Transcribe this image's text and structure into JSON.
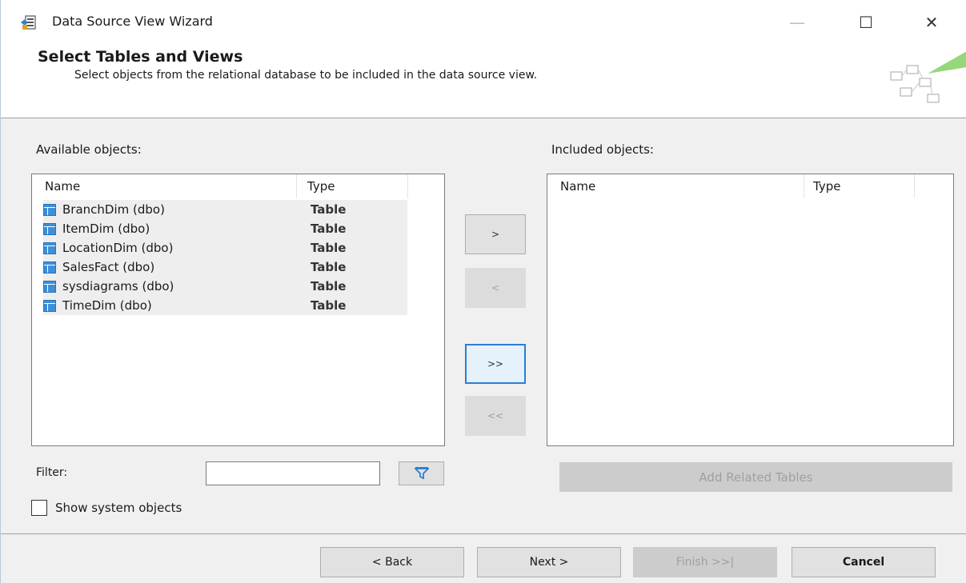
{
  "window": {
    "title": "Data Source View Wizard",
    "controls": {
      "minimize": "—",
      "maximize": "☐",
      "close": "✕"
    }
  },
  "header": {
    "title": "Select Tables and Views",
    "subtitle": "Select objects from the relational database to be included in the data source view."
  },
  "available": {
    "label": "Available objects:",
    "columns": {
      "name": "Name",
      "type": "Type"
    },
    "rows": [
      {
        "name": "BranchDim (dbo)",
        "type": "Table"
      },
      {
        "name": "ItemDim (dbo)",
        "type": "Table"
      },
      {
        "name": "LocationDim (dbo)",
        "type": "Table"
      },
      {
        "name": "SalesFact (dbo)",
        "type": "Table"
      },
      {
        "name": "sysdiagrams (dbo)",
        "type": "Table"
      },
      {
        "name": "TimeDim (dbo)",
        "type": "Table"
      }
    ]
  },
  "included": {
    "label": "Included objects:",
    "columns": {
      "name": "Name",
      "type": "Type"
    }
  },
  "transfer": {
    "add_one": ">",
    "remove_one": "<",
    "add_all": ">>",
    "remove_all": "<<"
  },
  "filter": {
    "label": "Filter:",
    "value": "",
    "icon": "funnel-icon"
  },
  "add_related_label": "Add Related Tables",
  "show_system_label": "Show system objects",
  "footer": {
    "back": "< Back",
    "next": "Next >",
    "finish": "Finish >>|",
    "cancel": "Cancel"
  },
  "colors": {
    "accent": "#2a7fd4",
    "table_icon": "#3d8fd8",
    "disabled_button": "#cccccc",
    "filter_icon": "#2a7fd4"
  }
}
